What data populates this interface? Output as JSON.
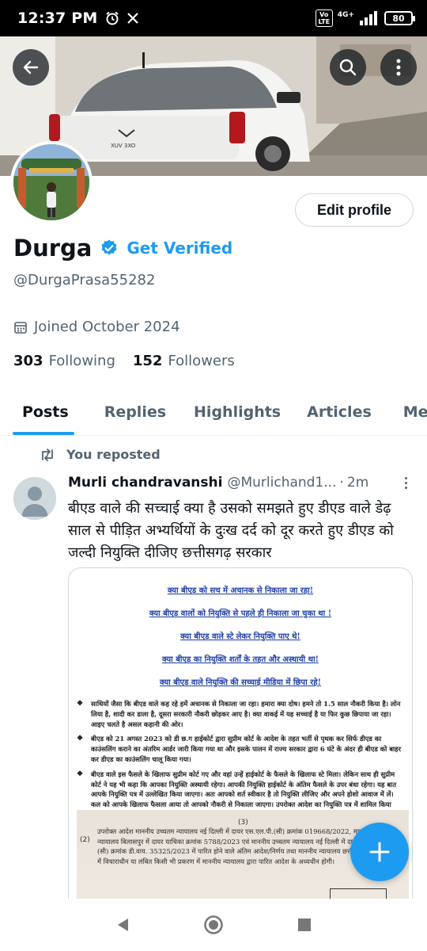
{
  "status_bar": {
    "time": "12:37 PM",
    "battery": "80",
    "network": "4G+",
    "volte": "Vo LTE",
    "icons": [
      "alarm-icon",
      "x-logo-icon",
      "signal-icon"
    ]
  },
  "header": {
    "back_icon": "arrow-left-icon",
    "search_icon": "search-icon",
    "more_icon": "more-vertical-icon"
  },
  "profile": {
    "name": "Durga",
    "get_verified": "Get Verified",
    "handle": "@DurgaPrasa55282",
    "joined": "Joined October 2024",
    "following_count": "303",
    "following_label": "Following",
    "followers_count": "152",
    "followers_label": "Followers",
    "edit_profile": "Edit profile"
  },
  "tabs": [
    {
      "label": "Posts",
      "active": true
    },
    {
      "label": "Replies",
      "active": false
    },
    {
      "label": "Highlights",
      "active": false
    },
    {
      "label": "Articles",
      "active": false
    },
    {
      "label": "Media",
      "active": false
    }
  ],
  "post": {
    "repost_label": "You reposted",
    "author": "Murli chandravanshi",
    "handle": "@Murlichand1...",
    "separator": "·",
    "time": "2m",
    "text": "बीएड वाले की सच्चाई क्या है उसको समझते हुए डीएड वाले डेढ़ साल से पीड़ित अभ्यर्थियों के दुःख दर्द को दूर करते हुए डीएड को जल्दी नियुक्ति दीजिए छत्तीसगढ़ सरकार",
    "document": {
      "headings": [
        "क्या बीएड को सच में अचानक से निकाला जा रहा!",
        "क्या बीएड वालों को नियुक्ति से पहले ही निकाला जा चुका था !",
        "क्या बीएड वाले स्टे लेकर नियुक्ति पाए थे!",
        "क्या बीएड का नियुक्ति शर्तों के तहत और अस्थायी था!",
        "क्या बीएड वाले नियुक्ति की सच्चाई मीडिया में छिपा रहे!"
      ],
      "bullets": [
        "साथियों जैसा कि बीएड वाले कह रहे हमें अचानक से निकाला जा रहा। हमारा क्या दोष। हमने तो 1.5 साल नौकरी किया है। लोन लिया है, शादी कर डाला है, दूसरा सरकारी नौकरी छोड़कर आए है। क्या वाकई में यह सच्चाई है या फिर कुछ छिपाया जा रहा। आइए चलते है असल कहानी की ओर।",
        "बीएड को 21 अगस्त 2023 को डी छ.ग हाईकोर्ट द्वारा सुप्रीम कोर्ट के आदेश के तहत भर्ती से पृथक कर सिर्फ डीएड का काउंसलिंग कराने का अंतरिम आर्डर जारी किया गया था और इसके पालन में राज्य सरकार द्वारा 6 घंटे के अंदर ही बीएड को बाहर कर डीएड का काउंसलिंग चालू किया गया।",
        "बीएड वाले इस फैसले के खिलाफ सुप्रीम कोर्ट गए और वहां उन्हें हाईकोर्ट के फैसले के खिलाफ स्टे मिला। लेकिन साथ ही सुप्रीम कोर्ट ने यह भी कहा कि आपका नियुक्ति अस्थायी रहेगा। आपकी नियुक्ति हाईकोर्ट के अंतिम फैसले के उपर बंधा रहेगा। यह बात आपके नियुक्ति पत्र में उल्लेखित किया जाएगा। अतः आपको शर्त स्वीकार है तो नियुक्ति लीजिए और अपने होशो आवाज में लें। कल को आपके खिलाफ फैसला आया तो आपको नौकरी से निकाला जाएगा। उपरोक्त आदेश का नियुक्ति पत्र में शामिल किया गया था:"
      ],
      "scan_page_no": "(3)",
      "scan_mark": "(2)",
      "scan_text": "उपरोक्त आदेश माननीय उच्चतम न्यायालय नई दिल्ली में दायर एस.एल.पी.(सी) क्रमांक 019668/2022, माननीय उच्च न्यायालय बिलासपुर में दायर याचिका क्रमांक 5788/2023 एवं माननीय उच्चतम न्यायालय नई दिल्ली में दायर एस.एल.पी.(सी) क्रमांक डी.वाय. 35325/2023 में पारित होने वाले अंतिम आदेश/निर्णय तथा माननीय न्यायालय छत्तीसगढ़, बिलासपुर में विचाराधीन या लंबित किसी भी प्रकरण में माननीय न्यायालय द्वारा पारित आदेश के अध्यधीन होगी।"
    }
  },
  "fab": {
    "icon": "plus-icon"
  },
  "nav_bar": {
    "icons": [
      "back-triangle-icon",
      "home-circle-icon",
      "recents-square-icon"
    ]
  },
  "colors": {
    "accent": "#1d9bf0",
    "text": "#0f1419",
    "secondary": "#536471",
    "border": "#cfd9de"
  }
}
